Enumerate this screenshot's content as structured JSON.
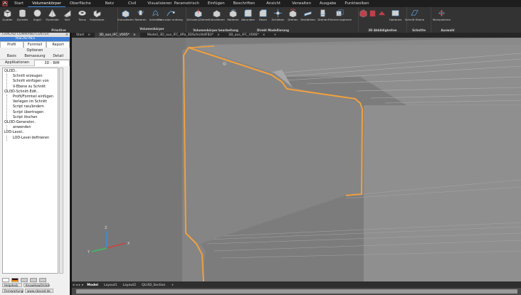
{
  "menu": {
    "items": [
      "Start",
      "Volumenkörper",
      "Oberfläche",
      "Netz",
      "Civil",
      "Visualisieren",
      "Parametrisch",
      "Einfügen",
      "Beschriften",
      "Ansicht",
      "Verwalten",
      "Ausgabe",
      "Punktwolken"
    ],
    "active": "Volumenkörper"
  },
  "ribbon": {
    "primitive": {
      "title": "Primitive",
      "buttons": [
        "Quader",
        "Zylinder",
        "Kugel",
        "Pyramide",
        "Keil",
        "Torus",
        "Polykörper"
      ]
    },
    "volumenkoerper": {
      "title": "Volumenkörper",
      "buttons": [
        "Extrudieren",
        "Rotieren",
        "Anheben",
        "Extrusion entlang"
      ]
    },
    "bearbeitung": {
      "title": "Volumenkörper bearbeitung",
      "buttons": [
        "Drücken/Ziehen",
        "Extrudieren",
        "Rotieren",
        "Abrunden",
        "Fasen",
        "Schieben",
        "Drehen",
        "Verstärken",
        "Drehen",
        "Flächen kopieren"
      ]
    },
    "direkt_title": "Direkt Modellierung",
    "abbild": {
      "title": "3D Abbildigkeiten",
      "buttons": [
        "Optionen"
      ]
    },
    "schnitte": {
      "title": "Schnitte",
      "buttons": [
        "Schnitt Ebene"
      ]
    },
    "auswahl": {
      "title": "Auswahl",
      "buttons": [
        "Manipulieren"
      ]
    }
  },
  "panel": {
    "title": "CRACAD COMMAND-CENTER",
    "subtitle": "thaCAD MLS",
    "tabs_row1": [
      "Profil",
      "Formteil",
      "Report"
    ],
    "tabs_row1_extra": "Optionen",
    "tabs_row2": [
      "Basis",
      "Bemassung",
      "Detail"
    ],
    "tabs_row3": [
      "Applikationen",
      "3D - BIM"
    ],
    "tree": [
      {
        "label": "QLI3D..",
        "children": [
          "Schnitt erzeugen",
          "Schnitt einfügen von",
          "V-Ebene zu Schnitt"
        ]
      },
      {
        "label": "QLI3D-Schnitt-Edit..",
        "children": [
          "Profil/Formteil einfügen",
          "Verlegen im Schnitt",
          "Script neu/ändern",
          "Script übertragen",
          "Script löschen"
        ]
      },
      {
        "label": "QLI3D-Generator..",
        "children": [
          "anwenden"
        ]
      },
      {
        "label": "LOD-Level..",
        "children": [
          "LOD-Level definieren"
        ]
      }
    ],
    "footer_buttons_1": [
      "Helpdesk",
      "KnowHowOnline"
    ],
    "footer_buttons_2": [
      "Fernwartung",
      "www.cbacad.de"
    ]
  },
  "doc_tabs": [
    "Start",
    "3D_aus_IFC_V005*",
    "Modell_3D_aus_IFC_4Pa_3DSchnitt4FB3*",
    "3D_aus_IFC_V006*"
  ],
  "doc_tabs_active": 1,
  "layout_tabs": [
    "Model",
    "Layout1",
    "Layout2",
    "QLI3D_Section"
  ],
  "layout_tabs_active": 0,
  "ucs": {
    "x": "X",
    "y": "Y",
    "z": "Z"
  },
  "colors": {
    "selection": "#f0a040",
    "menubar": "#1e1e1e",
    "ribbon": "#333333",
    "viewport": "#7c7c7c",
    "panel_accent": "#3e7fd6"
  }
}
